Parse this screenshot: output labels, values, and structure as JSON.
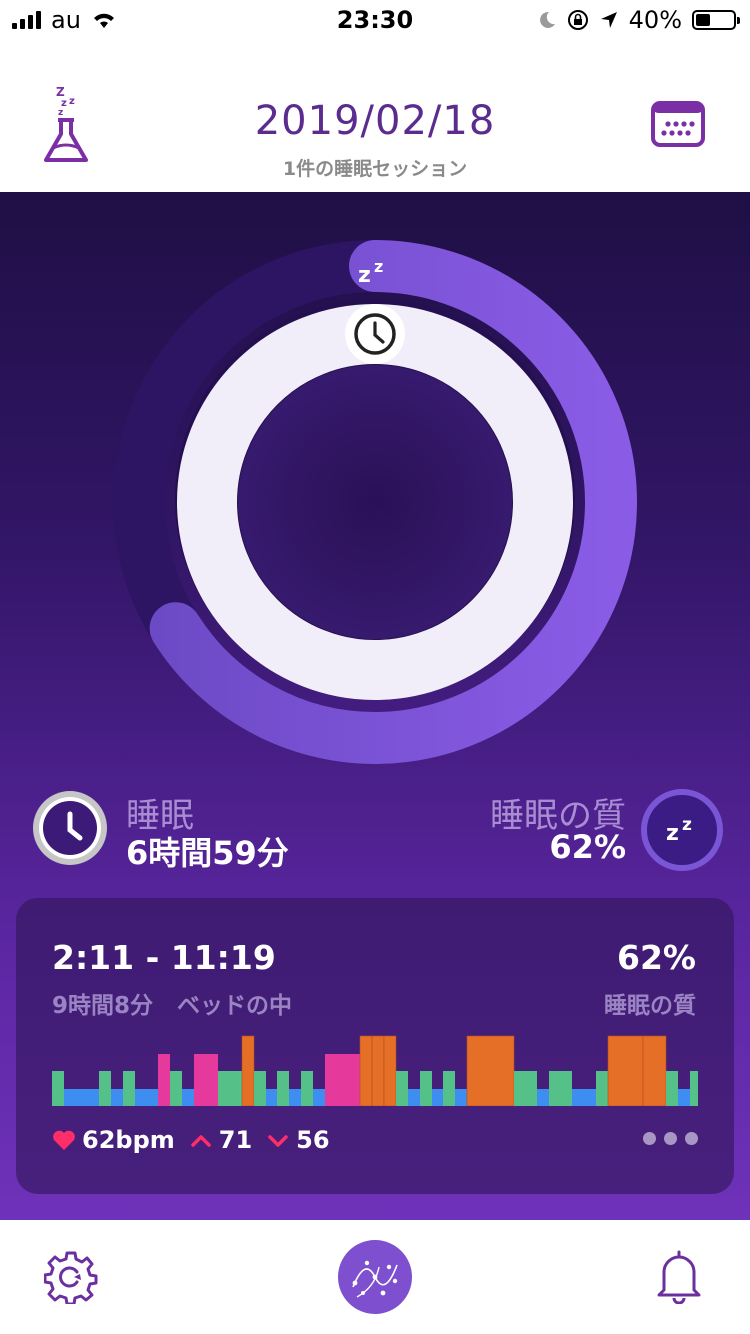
{
  "status_bar": {
    "carrier": "au",
    "time": "23:30",
    "battery": "40%",
    "battery_level": 0.4
  },
  "header": {
    "date": "2019/02/18",
    "subtitle": "1件の睡眠セッション",
    "left_icon": "sleep-flask-icon",
    "right_icon": "calendar-icon"
  },
  "ring": {
    "inner_icon": "clock-icon",
    "outer_icon": "zzz-icon",
    "progress_fraction": 0.66
  },
  "stats": {
    "sleep_label": "睡眠",
    "sleep_value": "6時間59分",
    "quality_label": "睡眠の質",
    "quality_value": "62%"
  },
  "session": {
    "time_range": "2:11 - 11:19",
    "duration": "9時間8分",
    "duration_suffix": "ベッドの中",
    "quality_value": "62%",
    "quality_label": "睡眠の質",
    "heart_rate": "62bpm",
    "hr_max": "71",
    "hr_min": "56"
  },
  "chart_data": {
    "type": "bar",
    "description_levels": [
      "blue",
      "green",
      "pink",
      "orange"
    ],
    "colors": {
      "blue": "#3d8ef0",
      "green": "#55c088",
      "pink": "#e53a9c",
      "orange": "#e66f28"
    },
    "segments": [
      {
        "c": "green",
        "w": 12
      },
      {
        "c": "blue",
        "w": 35
      },
      {
        "c": "green",
        "w": 12
      },
      {
        "c": "blue",
        "w": 12
      },
      {
        "c": "green",
        "w": 12
      },
      {
        "c": "blue",
        "w": 23
      },
      {
        "c": "pink",
        "w": 12
      },
      {
        "c": "green",
        "w": 12
      },
      {
        "c": "blue",
        "w": 12
      },
      {
        "c": "pink",
        "w": 24
      },
      {
        "c": "green",
        "w": 24
      },
      {
        "c": "orange",
        "w": 12
      },
      {
        "c": "green",
        "w": 12
      },
      {
        "c": "blue",
        "w": 11
      },
      {
        "c": "green",
        "w": 12
      },
      {
        "c": "blue",
        "w": 12
      },
      {
        "c": "green",
        "w": 12
      },
      {
        "c": "blue",
        "w": 12
      },
      {
        "c": "pink",
        "w": 35
      },
      {
        "c": "orange",
        "w": 12
      },
      {
        "c": "orange",
        "w": 12
      },
      {
        "c": "orange",
        "w": 12
      },
      {
        "c": "green",
        "w": 12
      },
      {
        "c": "blue",
        "w": 12
      },
      {
        "c": "green",
        "w": 12
      },
      {
        "c": "blue",
        "w": 11
      },
      {
        "c": "green",
        "w": 12
      },
      {
        "c": "blue",
        "w": 12
      },
      {
        "c": "orange",
        "w": 47
      },
      {
        "c": "green",
        "w": 23
      },
      {
        "c": "blue",
        "w": 12
      },
      {
        "c": "green",
        "w": 23
      },
      {
        "c": "blue",
        "w": 24
      },
      {
        "c": "green",
        "w": 12
      },
      {
        "c": "orange",
        "w": 35
      },
      {
        "c": "orange",
        "w": 23
      },
      {
        "c": "green",
        "w": 12
      },
      {
        "c": "blue",
        "w": 12
      },
      {
        "c": "green",
        "w": 11
      },
      {
        "c": "blue",
        "w": 11
      }
    ]
  },
  "tabbar": {
    "left_icon": "settings-gear-icon",
    "center_icon": "sleep-pattern-icon",
    "right_icon": "alarm-bell-icon"
  }
}
